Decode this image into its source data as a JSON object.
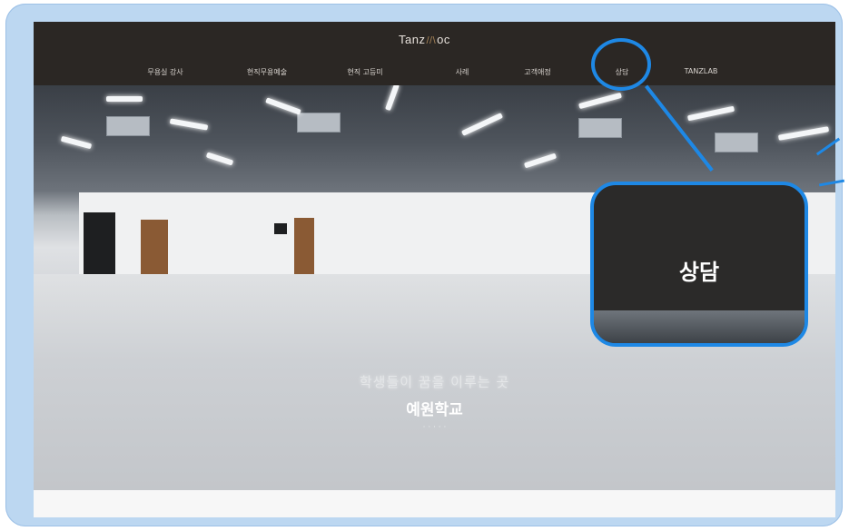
{
  "logo": {
    "text_left": "Tanz",
    "text_mark": "//\\",
    "text_right": "oc"
  },
  "nav": {
    "items": [
      {
        "label": "무용실 강사"
      },
      {
        "label": "현직무용예술"
      },
      {
        "label": "현직 고등미"
      },
      {
        "label": "사례"
      },
      {
        "label": "고객애정"
      },
      {
        "label": "상담"
      },
      {
        "label": "TANZLAB"
      }
    ]
  },
  "hero": {
    "line1": "학생들이 꿈을 이루는 곳",
    "line2": "예원학교",
    "line3": "· · · · ·"
  },
  "callout": {
    "label": "상담"
  },
  "colors": {
    "highlight": "#1e88e5",
    "navbar": "#2b2724"
  }
}
